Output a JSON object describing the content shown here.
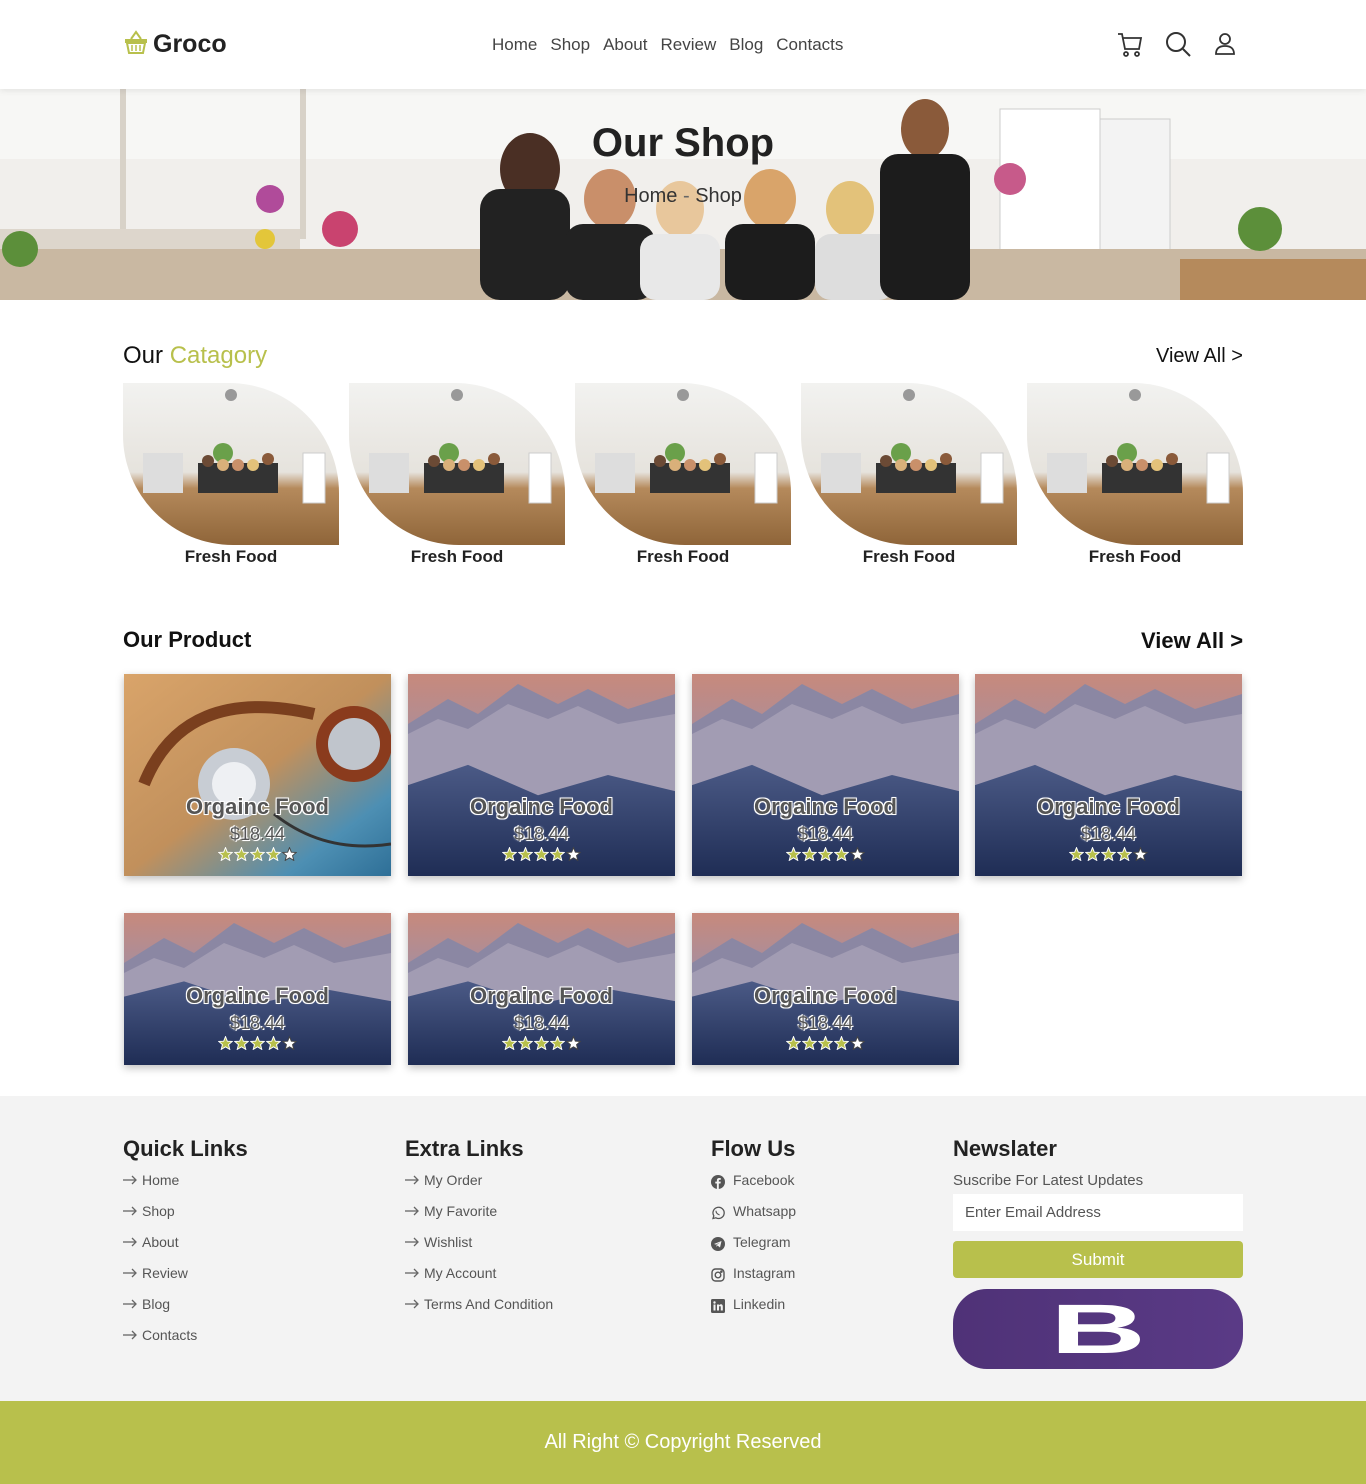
{
  "header": {
    "logo": "Groco",
    "nav": [
      "Home",
      "Shop",
      "About",
      "Review",
      "Blog",
      "Contacts"
    ],
    "icons": [
      "cart-icon",
      "search-icon",
      "user-icon"
    ]
  },
  "hero": {
    "title": "Our Shop",
    "breadcrumb": [
      "Home",
      "Shop"
    ]
  },
  "category": {
    "title_plain": "Our",
    "title_accent": "Catagory",
    "view_all": "View All >",
    "items": [
      "Fresh Food",
      "Fresh Food",
      "Fresh Food",
      "Fresh Food",
      "Fresh Food"
    ]
  },
  "products": {
    "title": "Our Product",
    "view_all": "View All >",
    "items": [
      {
        "name": "Orgainc Food",
        "price": "$18.44",
        "rating": 4,
        "image": "headphones"
      },
      {
        "name": "Orgainc Food",
        "price": "$18.44",
        "rating": 4,
        "image": "mountain"
      },
      {
        "name": "Orgainc Food",
        "price": "$18.44",
        "rating": 4,
        "image": "mountain"
      },
      {
        "name": "Orgainc Food",
        "price": "$18.44",
        "rating": 4,
        "image": "mountain"
      },
      {
        "name": "Orgainc Food",
        "price": "$18.44",
        "rating": 4,
        "image": "mountain"
      },
      {
        "name": "Orgainc Food",
        "price": "$18.44",
        "rating": 4,
        "image": "mountain"
      },
      {
        "name": "Orgainc Food",
        "price": "$18.44",
        "rating": 4,
        "image": "mountain"
      }
    ]
  },
  "footer": {
    "quick_links": {
      "title": "Quick Links",
      "items": [
        "Home",
        "Shop",
        "About",
        "Review",
        "Blog",
        "Contacts"
      ]
    },
    "extra_links": {
      "title": "Extra Links",
      "items": [
        "My Order",
        "My Favorite",
        "Wishlist",
        "My Account",
        "Terms And Condition"
      ]
    },
    "follow": {
      "title": "Flow Us",
      "items": [
        {
          "label": "Facebook",
          "icon": "facebook-icon"
        },
        {
          "label": "Whatsapp",
          "icon": "whatsapp-icon"
        },
        {
          "label": "Telegram",
          "icon": "telegram-icon"
        },
        {
          "label": "Instagram",
          "icon": "instagram-icon"
        },
        {
          "label": "Linkedin",
          "icon": "linkedin-icon"
        }
      ]
    },
    "newsletter": {
      "title": "Newslater",
      "subtitle": "Suscribe For Latest Updates",
      "placeholder": "Enter Email Address",
      "button": "Submit",
      "logo_letter": "B"
    }
  },
  "copyright": "All Right © Copyright Reserved",
  "colors": {
    "accent": "#b8c04c",
    "footer_bg": "#f3f3f3",
    "star": "#b8c04c"
  }
}
